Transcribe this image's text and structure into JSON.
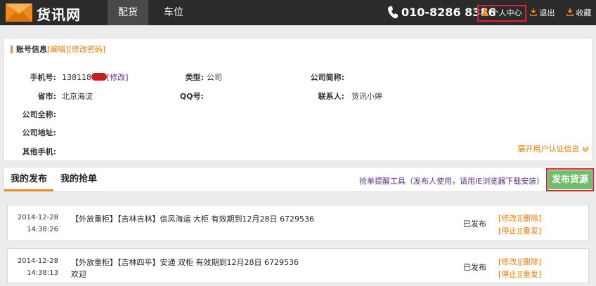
{
  "header": {
    "brand": "货讯网",
    "nav": [
      "配货",
      "车位"
    ],
    "phone": "010-8286 8386",
    "user_center": "个人中心",
    "logout": "退出",
    "favorite": "收藏",
    "accent": "#f08a1c"
  },
  "account": {
    "title": "账号信息",
    "edit": "[编辑]",
    "change_pwd": "[修改密码]",
    "fields": {
      "mobile_label": "手机号:",
      "mobile_value": "138118",
      "mobile_edit": "[修改]",
      "type_label": "类型:",
      "type_value": "公司",
      "short_name_label": "公司简称:",
      "city_label": "省市:",
      "city_value": "北京海淀",
      "qq_label": "QQ号:",
      "contact_label": "联系人:",
      "contact_value": "货讯小婷",
      "full_name_label": "公司全称:",
      "address_label": "公司地址:",
      "other_phone_label": "其他手机:"
    },
    "expand": "展开用户认证信息"
  },
  "tabs": {
    "items": [
      "我的发布",
      "我的抢单"
    ],
    "tip": "抢单提醒工具（发布人使用，请用IE浏览器下载安装）",
    "publish_button": "发布货源"
  },
  "records": [
    {
      "date": "2014-12-28",
      "time": "14:38:26",
      "desc": "【外放重柜】【吉林吉林】信风海运 大柜 有效期到12月28日 6729536",
      "note": "",
      "status": "已发布",
      "act1": "[修改][删除]",
      "act2": "[停止][重发]"
    },
    {
      "date": "2014-12-28",
      "time": "14:38:13",
      "desc": "【外放重柜】【吉林四平】安通 双柜 有效期到12月28日 6729536",
      "note": "欢迎",
      "status": "已发布",
      "act1": "[修改][删除]",
      "act2": "[停止][重发]"
    }
  ]
}
